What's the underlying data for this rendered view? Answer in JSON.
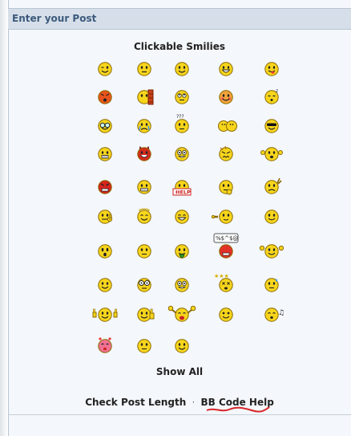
{
  "panel": {
    "header_title": "Enter your Post",
    "smilies_title": "Clickable Smilies",
    "show_all": "Show All",
    "check_length": "Check Post Length",
    "separator": "·",
    "bbcode_help": "BB Code Help"
  },
  "colors": {
    "header_bg": "#d6dfe9",
    "header_text": "#3c5a7c",
    "panel_bg": "#f4f7fb",
    "smilie_yellow": "#f7d51c",
    "smilie_outline": "#8a6a00",
    "scribble_red": "#d7262a"
  },
  "smilies": [
    {
      "name": "wink",
      "kind": "wink"
    },
    {
      "name": "confused",
      "kind": "worried"
    },
    {
      "name": "smile",
      "kind": "smile"
    },
    {
      "name": "biggrin",
      "kind": "grin"
    },
    {
      "name": "tongue",
      "kind": "tongue"
    },
    {
      "name": "mad",
      "kind": "mad"
    },
    {
      "name": "banghead",
      "kind": "bang"
    },
    {
      "name": "rolleyes",
      "kind": "roll"
    },
    {
      "name": "redface",
      "kind": "blush"
    },
    {
      "name": "sleep",
      "kind": "sleepy"
    },
    {
      "name": "shock",
      "kind": "glasses"
    },
    {
      "name": "cry",
      "kind": "cry"
    },
    {
      "name": "confused2",
      "kind": "question"
    },
    {
      "name": "hug",
      "kind": "two"
    },
    {
      "name": "cool",
      "kind": "cool"
    },
    {
      "name": "grr",
      "kind": "teeth"
    },
    {
      "name": "devil",
      "kind": "devil"
    },
    {
      "name": "eek",
      "kind": "wideeyes"
    },
    {
      "name": "argh",
      "kind": "argh"
    },
    {
      "name": "wave",
      "kind": "wave"
    },
    {
      "name": "angry",
      "kind": "angry"
    },
    {
      "name": "grin2",
      "kind": "teeth2"
    },
    {
      "name": "help",
      "kind": "help"
    },
    {
      "name": "thinking",
      "kind": "think"
    },
    {
      "name": "sad",
      "kind": "sad"
    },
    {
      "name": "finger",
      "kind": "finger"
    },
    {
      "name": "angel",
      "kind": "halo"
    },
    {
      "name": "laugh",
      "kind": "laugh"
    },
    {
      "name": "point",
      "kind": "point"
    },
    {
      "name": "happy",
      "kind": "smile2"
    },
    {
      "name": "surprised",
      "kind": "ooh"
    },
    {
      "name": "unsure",
      "kind": "plain"
    },
    {
      "name": "sick",
      "kind": "sick"
    },
    {
      "name": "swear",
      "kind": "swear"
    },
    {
      "name": "cheer",
      "kind": "cheer"
    },
    {
      "name": "smile3",
      "kind": "smile"
    },
    {
      "name": "bigeyes",
      "kind": "bigeyes"
    },
    {
      "name": "wideeyes2",
      "kind": "wideeyes"
    },
    {
      "name": "dizzy",
      "kind": "dizzy"
    },
    {
      "name": "sweat",
      "kind": "sweat"
    },
    {
      "name": "thumbsup2",
      "kind": "twothumbs"
    },
    {
      "name": "thumbsup",
      "kind": "thumb"
    },
    {
      "name": "hurray",
      "kind": "hurray"
    },
    {
      "name": "blink",
      "kind": "blink"
    },
    {
      "name": "music",
      "kind": "music"
    },
    {
      "name": "love",
      "kind": "love"
    },
    {
      "name": "neutral",
      "kind": "plain"
    },
    {
      "name": "content",
      "kind": "smile"
    }
  ]
}
